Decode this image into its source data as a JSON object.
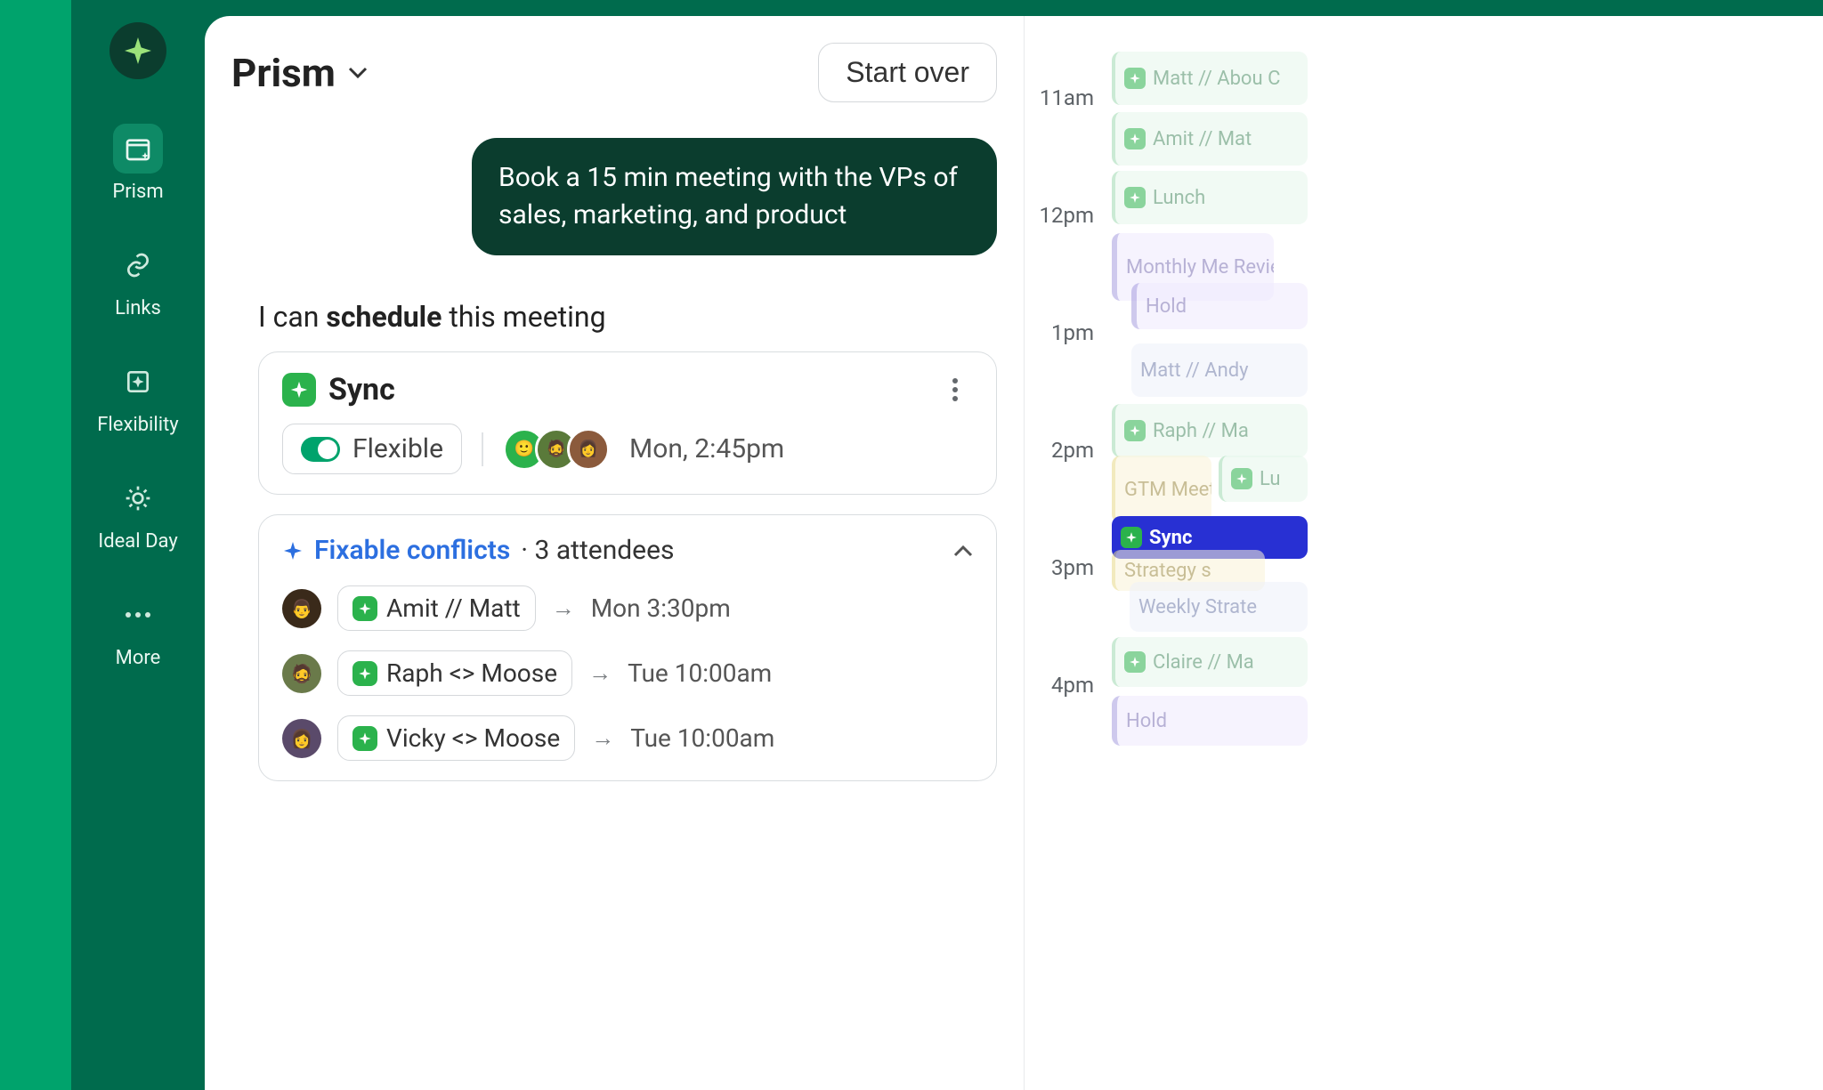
{
  "sidebar": {
    "items": [
      {
        "label": "Prism"
      },
      {
        "label": "Links"
      },
      {
        "label": "Flexibility"
      },
      {
        "label": "Ideal Day"
      },
      {
        "label": "More"
      }
    ]
  },
  "header": {
    "title": "Prism",
    "start_over": "Start over"
  },
  "chat": {
    "user_message": "Book a 15 min meeting with the VPs of sales, marketing, and product",
    "assistant_prefix": "I can ",
    "assistant_bold": "schedule",
    "assistant_suffix": " this meeting"
  },
  "sync_card": {
    "title": "Sync",
    "flexible_label": "Flexible",
    "datetime": "Mon, 2:45pm"
  },
  "conflicts": {
    "fixable_label": "Fixable conflicts",
    "attendees_label": "3 attendees",
    "rows": [
      {
        "meeting": "Amit // Matt",
        "newtime": "Mon 3:30pm"
      },
      {
        "meeting": "Raph <> Moose",
        "newtime": "Tue 10:00am"
      },
      {
        "meeting": "Vicky <> Moose",
        "newtime": "Tue 10:00am"
      }
    ]
  },
  "calendar": {
    "hours": [
      "11am",
      "12pm",
      "1pm",
      "2pm",
      "3pm",
      "4pm"
    ],
    "events": [
      {
        "label": "Matt // Abou C"
      },
      {
        "label": "Amit // Mat"
      },
      {
        "label": "Lunch"
      },
      {
        "label": "Monthly Me Review"
      },
      {
        "label": "Hold"
      },
      {
        "label": "Matt // Andy"
      },
      {
        "label": "Raph // Ma"
      },
      {
        "label": "GTM Meeting"
      },
      {
        "label": "Lu"
      },
      {
        "label": "Sync"
      },
      {
        "label": "Strategy s"
      },
      {
        "label": "Weekly Strate"
      },
      {
        "label": "Claire // Ma"
      },
      {
        "label": "Hold"
      }
    ]
  }
}
